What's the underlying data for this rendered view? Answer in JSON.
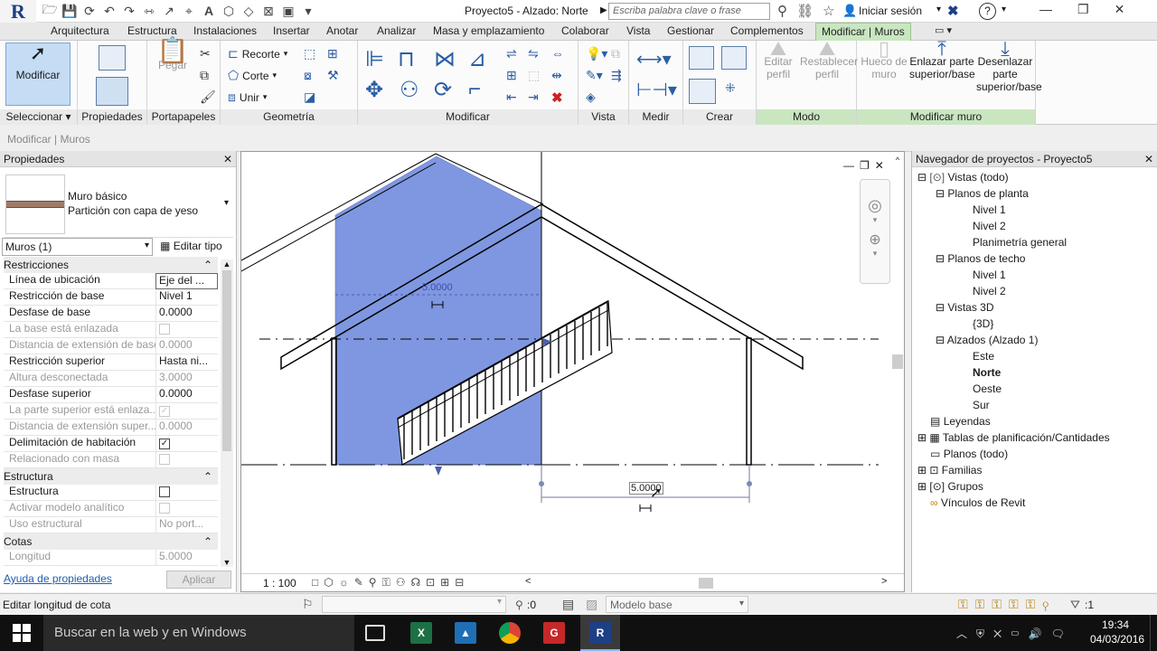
{
  "title_bar": {
    "logo": "R",
    "document_title": "Proyecto5 - Alzado: Norte",
    "search_placeholder": "Escriba palabra clave o frase",
    "signin": "Iniciar sesión",
    "help": "?"
  },
  "ribbon_tabs": [
    "Arquitectura",
    "Estructura",
    "Instalaciones",
    "Insertar",
    "Anotar",
    "Analizar",
    "Masa y emplazamiento",
    "Colaborar",
    "Vista",
    "Gestionar",
    "Complementos",
    "Modificar | Muros"
  ],
  "ribbon": {
    "modificar_label": "Modificar",
    "pegar_label": "Pegar",
    "recorte_label": "Recorte",
    "corte_label": "Corte",
    "unir_label": "Unir",
    "editar_perfil_label": "Editar perfil",
    "restablecer_perfil_label": "Restablecer perfil",
    "hueco_label": "Hueco de muro",
    "enlazar_label": "Enlazar parte superior/base",
    "desenlazar_label": "Desenlazar parte superior/base",
    "panels": {
      "seleccionar": "Seleccionar",
      "propiedades": "Propiedades",
      "portapapeles": "Portapapeles",
      "geometria": "Geometría",
      "modificar": "Modificar",
      "vista": "Vista",
      "medir": "Medir",
      "crear": "Crear",
      "modo": "Modo",
      "modificar_muro": "Modificar muro"
    }
  },
  "context_bar": "Modificar | Muros",
  "properties": {
    "title": "Propiedades",
    "type_family": "Muro básico",
    "type_name": "Partición con capa de yeso",
    "selector": "Muros (1)",
    "edit_type": "Editar tipo",
    "sections": {
      "restricciones": "Restricciones",
      "estructura": "Estructura",
      "cotas": "Cotas"
    },
    "rows": [
      {
        "k": "Línea de ubicación",
        "v": "Eje del ..."
      },
      {
        "k": "Restricción de base",
        "v": "Nivel 1"
      },
      {
        "k": "Desfase de base",
        "v": "0.0000"
      },
      {
        "k": "La base está enlazada",
        "v": ""
      },
      {
        "k": "Distancia de extensión de base",
        "v": "0.0000"
      },
      {
        "k": "Restricción superior",
        "v": "Hasta ni..."
      },
      {
        "k": "Altura desconectada",
        "v": "3.0000"
      },
      {
        "k": "Desfase superior",
        "v": "0.0000"
      },
      {
        "k": "La parte superior está enlaza...",
        "v": ""
      },
      {
        "k": "Distancia de extensión super...",
        "v": "0.0000"
      },
      {
        "k": "Delimitación de habitación",
        "v": ""
      },
      {
        "k": "Relacionado con masa",
        "v": ""
      }
    ],
    "rows2": [
      {
        "k": "Estructura",
        "v": ""
      },
      {
        "k": "Activar modelo analítico",
        "v": ""
      },
      {
        "k": "Uso estructural",
        "v": "No port..."
      }
    ],
    "rows3": [
      {
        "k": "Longitud",
        "v": "5.0000"
      }
    ],
    "help_link": "Ayuda de propiedades",
    "apply": "Aplicar"
  },
  "view": {
    "dim_top": "5.0000",
    "dim_bottom": "5.0000",
    "scale": "1 : 100"
  },
  "navigator": {
    "title": "Navegador de proyectos - Proyecto5",
    "items": [
      {
        "label": "Vistas (todo)"
      },
      {
        "label": "Planos de planta"
      },
      {
        "label": "Nivel 1"
      },
      {
        "label": "Nivel 2"
      },
      {
        "label": "Planimetría general"
      },
      {
        "label": "Planos de techo"
      },
      {
        "label": "Nivel 1"
      },
      {
        "label": "Nivel 2"
      },
      {
        "label": "Vistas 3D"
      },
      {
        "label": "{3D}"
      },
      {
        "label": "Alzados (Alzado 1)"
      },
      {
        "label": "Este"
      },
      {
        "label": "Norte"
      },
      {
        "label": "Oeste"
      },
      {
        "label": "Sur"
      },
      {
        "label": "Leyendas"
      },
      {
        "label": "Tablas de planificación/Cantidades"
      },
      {
        "label": "Planos (todo)"
      },
      {
        "label": "Familias"
      },
      {
        "label": "Grupos"
      },
      {
        "label": "Vínculos de Revit"
      }
    ]
  },
  "status": {
    "message": "Editar longitud de cota",
    "zero": ":0",
    "model": "Modelo base",
    "filter_count": ":1"
  },
  "taskbar": {
    "search": "Buscar en la web y en Windows",
    "time": "19:34",
    "date": "04/03/2016"
  }
}
